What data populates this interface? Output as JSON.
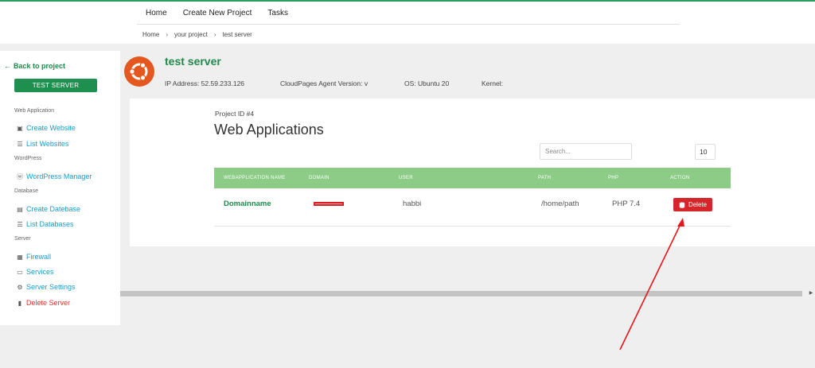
{
  "topnav": [
    "Home",
    "Create New Project",
    "Tasks"
  ],
  "breadcrumb": [
    "Home",
    "your project",
    "test server"
  ],
  "breadcrumb_sep": "›",
  "sidebar": {
    "back_label": "Back to project",
    "back_icon": "←",
    "server_button": "TEST SERVER",
    "sections": {
      "web": "Web Application",
      "wordpress": "WordPress",
      "database": "Database",
      "server": "Server"
    },
    "items": {
      "create_website": "Create Website",
      "list_websites": "List Websites",
      "wp_manager": "WordPress Manager",
      "create_database": "Create Datebase",
      "list_databases": "List Databases",
      "firewall": "Firewall",
      "services": "Services",
      "server_settings": "Server Settings",
      "delete_server": "Delete Server"
    },
    "icons": {
      "create_website": "▣",
      "list_websites": "☰",
      "wp_manager": "ⓦ",
      "create_database": "▤",
      "list_databases": "☰",
      "firewall": "▦",
      "services": "▭",
      "server_settings": "⚙",
      "delete_server": "▮"
    }
  },
  "header": {
    "title": "test server",
    "ip": "IP Address: 52.59.233.126",
    "agent": "CloudPages Agent Version: v",
    "os": "OS: Ubuntu 20",
    "kernel": "Kernel:"
  },
  "main": {
    "project_id": "Project ID #4",
    "title": "Web Applications",
    "search_placeholder": "Search...",
    "page_size": "10",
    "columns": [
      "WEBAPPLICATION NAME",
      "DOMAIN",
      "USER",
      "PATH",
      "PHP",
      "ACTION"
    ],
    "rows": [
      {
        "name": "Domainname",
        "domain": "",
        "user": "habbi",
        "path": "/home/path",
        "php": "PHP 7.4",
        "action": "Delete"
      }
    ]
  },
  "colors": {
    "brand_green": "#1f8a4c",
    "table_header": "#8ccc86",
    "danger": "#d4262b",
    "link_blue": "#1a9bc9",
    "ubuntu_orange": "#e4571f",
    "annotation_arrow": "#e8151b"
  }
}
